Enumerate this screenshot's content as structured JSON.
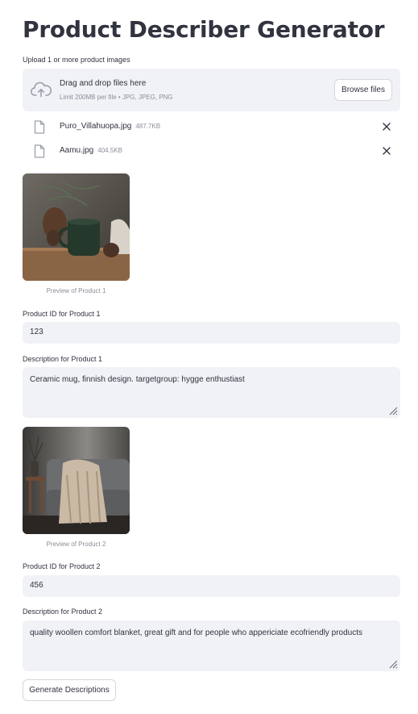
{
  "page": {
    "title": "Product Describer Generator"
  },
  "uploader": {
    "label": "Upload 1 or more product images",
    "drop_title": "Drag and drop files here",
    "drop_subtitle": "Limit 200MB per file • JPG, JPEG, PNG",
    "browse_label": "Browse files",
    "files": [
      {
        "name": "Puro_Villahuopa.jpg",
        "size": "487.7KB"
      },
      {
        "name": "Aamu.jpg",
        "size": "404.5KB"
      }
    ]
  },
  "products": [
    {
      "caption": "Preview of Product 1",
      "id_label": "Product ID for Product 1",
      "id_value": "123",
      "desc_label": "Description for Product 1",
      "desc_value": "Ceramic mug, finnish design. targetgroup: hygge enthustiast"
    },
    {
      "caption": "Preview of Product 2",
      "id_label": "Product ID for Product 2",
      "id_value": "456",
      "desc_label": "Description for Product 2",
      "desc_value": "quality woollen comfort blanket, great gift and for people who appericiate ecofriendly products"
    }
  ],
  "generate_label": "Generate Descriptions",
  "colors": {
    "field_bg": "#f0f2f6",
    "text": "#31333f",
    "muted": "#8a8d97",
    "border": "#d5d7dd"
  },
  "icons": [
    "cloud-upload-icon",
    "file-icon",
    "close-icon",
    "resize-handle-icon"
  ]
}
